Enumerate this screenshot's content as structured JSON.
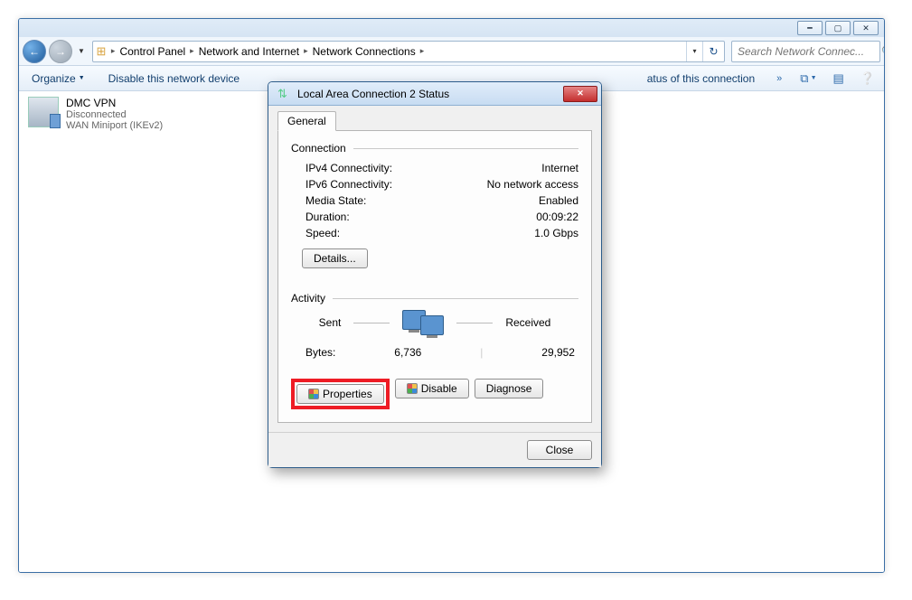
{
  "window": {
    "min_aria": "Minimize",
    "max_aria": "Maximize",
    "close_aria": "Close"
  },
  "breadcrumb": {
    "items": [
      "Control Panel",
      "Network and Internet",
      "Network Connections"
    ],
    "sep": "▸"
  },
  "search": {
    "placeholder": "Search Network Connec..."
  },
  "toolbar": {
    "organize": "Organize",
    "disable": "Disable this network device",
    "status_partial": "atus of this connection",
    "more": "»"
  },
  "connections": [
    {
      "name": "DMC VPN",
      "status": "Disconnected",
      "detail": "WAN Miniport (IKEv2)"
    }
  ],
  "dialog": {
    "title": "Local Area Connection 2 Status",
    "tab": "General",
    "conn_group": "Connection",
    "rows": {
      "ipv4l": "IPv4 Connectivity:",
      "ipv4v": "Internet",
      "ipv6l": "IPv6 Connectivity:",
      "ipv6v": "No network access",
      "medl": "Media State:",
      "medv": "Enabled",
      "durl": "Duration:",
      "durv": "00:09:22",
      "spdl": "Speed:",
      "spdv": "1.0 Gbps"
    },
    "details_btn": "Details...",
    "activity_group": "Activity",
    "sent": "Sent",
    "received": "Received",
    "bytes_label": "Bytes:",
    "bytes_sent": "6,736",
    "bytes_recv": "29,952",
    "properties": "Properties",
    "disable": "Disable",
    "diagnose": "Diagnose",
    "close": "Close"
  }
}
